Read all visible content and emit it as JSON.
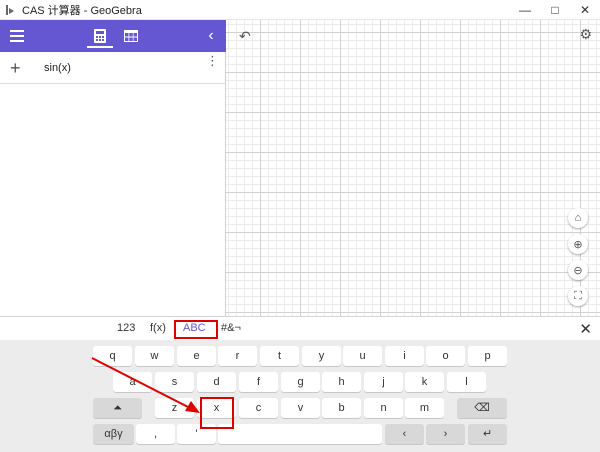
{
  "window": {
    "title": "CAS 计算器 - GeoGebra",
    "controls": [
      "—",
      "□",
      "✕"
    ]
  },
  "algebra": {
    "toolbar": {
      "menu_icon": "hamburger-menu-icon",
      "calculator_icon": "calculator-icon",
      "table_icon": "table-icon",
      "collapse_icon": "chevron-left-icon"
    },
    "rows": [
      {
        "add_symbol": "+",
        "expression": "sin(x)",
        "more_icon": "⋮"
      }
    ]
  },
  "graphics": {
    "undo_icon": "undo-icon",
    "settings_icon": "gear-icon",
    "view_buttons": [
      "home-icon",
      "zoom-in-icon",
      "zoom-out-icon",
      "fullscreen-icon"
    ]
  },
  "keyboard": {
    "tabs": [
      "123",
      "f(x)",
      "ABC",
      "#&¬"
    ],
    "active_tab": "ABC",
    "close_symbol": "✕",
    "row1": [
      "q",
      "w",
      "e",
      "r",
      "t",
      "y",
      "u",
      "i",
      "o",
      "p"
    ],
    "row2": [
      "a",
      "s",
      "d",
      "f",
      "g",
      "h",
      "j",
      "k",
      "l"
    ],
    "row3": [
      "z",
      "x",
      "c",
      "v",
      "b",
      "n",
      "m"
    ],
    "shift_symbol": "⏶",
    "backspace_symbol": "⌫",
    "greek_label": "αβγ",
    "comma": ",",
    "apostrophe": "'",
    "left_arrow": "‹",
    "right_arrow": "›",
    "enter_symbol": "↵"
  },
  "annotation": {
    "highlight_color": "#e00000",
    "targets": [
      "ABC",
      "x"
    ]
  },
  "colors": {
    "accent": "#6557d2",
    "toolbar_bg": "#6557d2",
    "keyboard_bg": "#ececec"
  }
}
